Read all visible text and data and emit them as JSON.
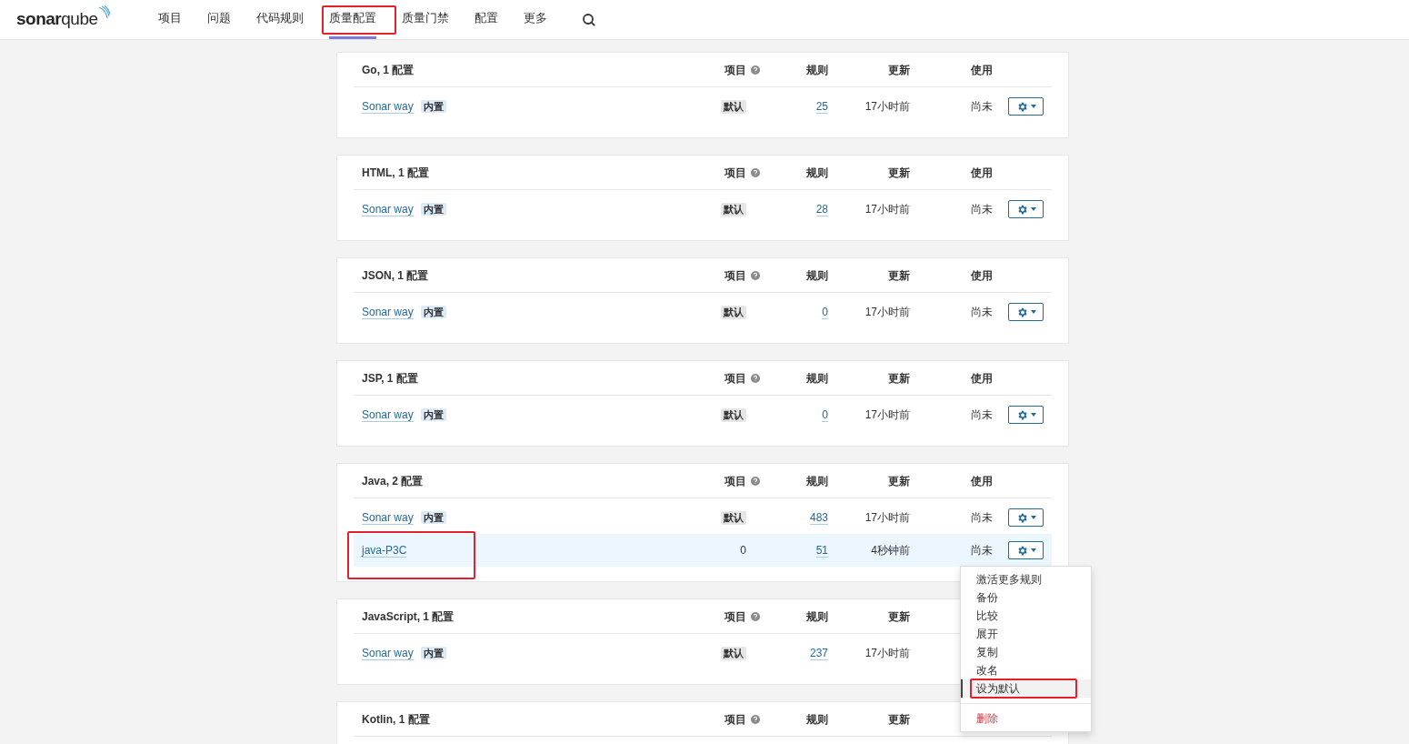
{
  "logo": "**sonar**qube",
  "nav": [
    {
      "label": "项目",
      "selected": false,
      "annotated": false
    },
    {
      "label": "问题",
      "selected": false,
      "annotated": false
    },
    {
      "label": "代码规则",
      "selected": false,
      "annotated": false
    },
    {
      "label": "质量配置",
      "selected": true,
      "annotated": true
    },
    {
      "label": "质量门禁",
      "selected": false,
      "annotated": false
    },
    {
      "label": "配置",
      "selected": false,
      "annotated": false
    },
    {
      "label": "更多",
      "selected": false,
      "annotated": false
    }
  ],
  "profiles": [
    {
      "title": "Go, 1 配置",
      "columns": [
        {
          "label": "项目",
          "help": true
        },
        {
          "label": "规则",
          "help": false
        },
        {
          "label": "更新",
          "help": false
        },
        {
          "label": "使用",
          "help": false
        }
      ],
      "rows": [
        {
          "name": "Sonar way",
          "tag": "内置",
          "projects": {
            "kind": "badge",
            "text": "默认"
          },
          "rules": "25",
          "updated": "17小时前",
          "usage": "尚未",
          "menu_button": true,
          "selected": false,
          "annotated": false
        }
      ]
    },
    {
      "title": "HTML, 1 配置",
      "columns": [
        {
          "label": "项目",
          "help": true
        },
        {
          "label": "规则",
          "help": false
        },
        {
          "label": "更新",
          "help": false
        },
        {
          "label": "使用",
          "help": false
        }
      ],
      "rows": [
        {
          "name": "Sonar way",
          "tag": "内置",
          "projects": {
            "kind": "badge",
            "text": "默认"
          },
          "rules": "28",
          "updated": "17小时前",
          "usage": "尚未",
          "menu_button": true,
          "selected": false,
          "annotated": false
        }
      ]
    },
    {
      "title": "JSON, 1 配置",
      "columns": [
        {
          "label": "项目",
          "help": true
        },
        {
          "label": "规则",
          "help": false
        },
        {
          "label": "更新",
          "help": false
        },
        {
          "label": "使用",
          "help": false
        }
      ],
      "rows": [
        {
          "name": "Sonar way",
          "tag": "内置",
          "projects": {
            "kind": "badge",
            "text": "默认"
          },
          "rules": "0",
          "updated": "17小时前",
          "usage": "尚未",
          "menu_button": true,
          "selected": false,
          "annotated": false
        }
      ]
    },
    {
      "title": "JSP, 1 配置",
      "columns": [
        {
          "label": "项目",
          "help": true
        },
        {
          "label": "规则",
          "help": false
        },
        {
          "label": "更新",
          "help": false
        },
        {
          "label": "使用",
          "help": false
        }
      ],
      "rows": [
        {
          "name": "Sonar way",
          "tag": "内置",
          "projects": {
            "kind": "badge",
            "text": "默认"
          },
          "rules": "0",
          "updated": "17小时前",
          "usage": "尚未",
          "menu_button": true,
          "selected": false,
          "annotated": false
        }
      ]
    },
    {
      "title": "Java, 2 配置",
      "columns": [
        {
          "label": "项目",
          "help": true
        },
        {
          "label": "规则",
          "help": false
        },
        {
          "label": "更新",
          "help": false
        },
        {
          "label": "使用",
          "help": false
        }
      ],
      "rows": [
        {
          "name": "Sonar way",
          "tag": "内置",
          "projects": {
            "kind": "badge",
            "text": "默认"
          },
          "rules": "483",
          "updated": "17小时前",
          "usage": "尚未",
          "menu_button": true,
          "selected": false,
          "annotated": false
        },
        {
          "name": "java-P3C",
          "projects": {
            "kind": "count",
            "text": "0"
          },
          "rules": "51",
          "updated": "4秒钟前",
          "usage": "尚未",
          "menu_button": true,
          "selected": true,
          "annotated": true
        }
      ]
    },
    {
      "title": "JavaScript, 1 配置",
      "columns": [
        {
          "label": "项目",
          "help": true
        },
        {
          "label": "规则",
          "help": false
        },
        {
          "label": "更新",
          "help": false
        }
      ],
      "rows": [
        {
          "name": "Sonar way",
          "tag": "内置",
          "projects": {
            "kind": "badge",
            "text": "默认"
          },
          "rules": "237",
          "updated": "17小时前",
          "selected": false,
          "annotated": false
        }
      ]
    },
    {
      "title": "Kotlin, 1 配置",
      "columns": [
        {
          "label": "项目",
          "help": true
        },
        {
          "label": "规则",
          "help": false
        },
        {
          "label": "更新",
          "help": false
        }
      ]
    }
  ],
  "menu": {
    "items": [
      {
        "label": "激活更多规则",
        "kind": "item",
        "selected": false,
        "annotated": false
      },
      {
        "label": "备份",
        "kind": "item",
        "selected": false,
        "annotated": false
      },
      {
        "label": "比较",
        "kind": "item",
        "selected": false,
        "annotated": false
      },
      {
        "label": "展开",
        "kind": "item",
        "selected": false,
        "annotated": false
      },
      {
        "label": "复制",
        "kind": "item",
        "selected": false,
        "annotated": false
      },
      {
        "label": "改名",
        "kind": "item",
        "selected": false,
        "annotated": false
      },
      {
        "label": "设为默认",
        "kind": "item",
        "selected": true,
        "annotated": true
      },
      {
        "label": "删除",
        "kind": "danger",
        "selected": false,
        "annotated": false
      }
    ]
  }
}
